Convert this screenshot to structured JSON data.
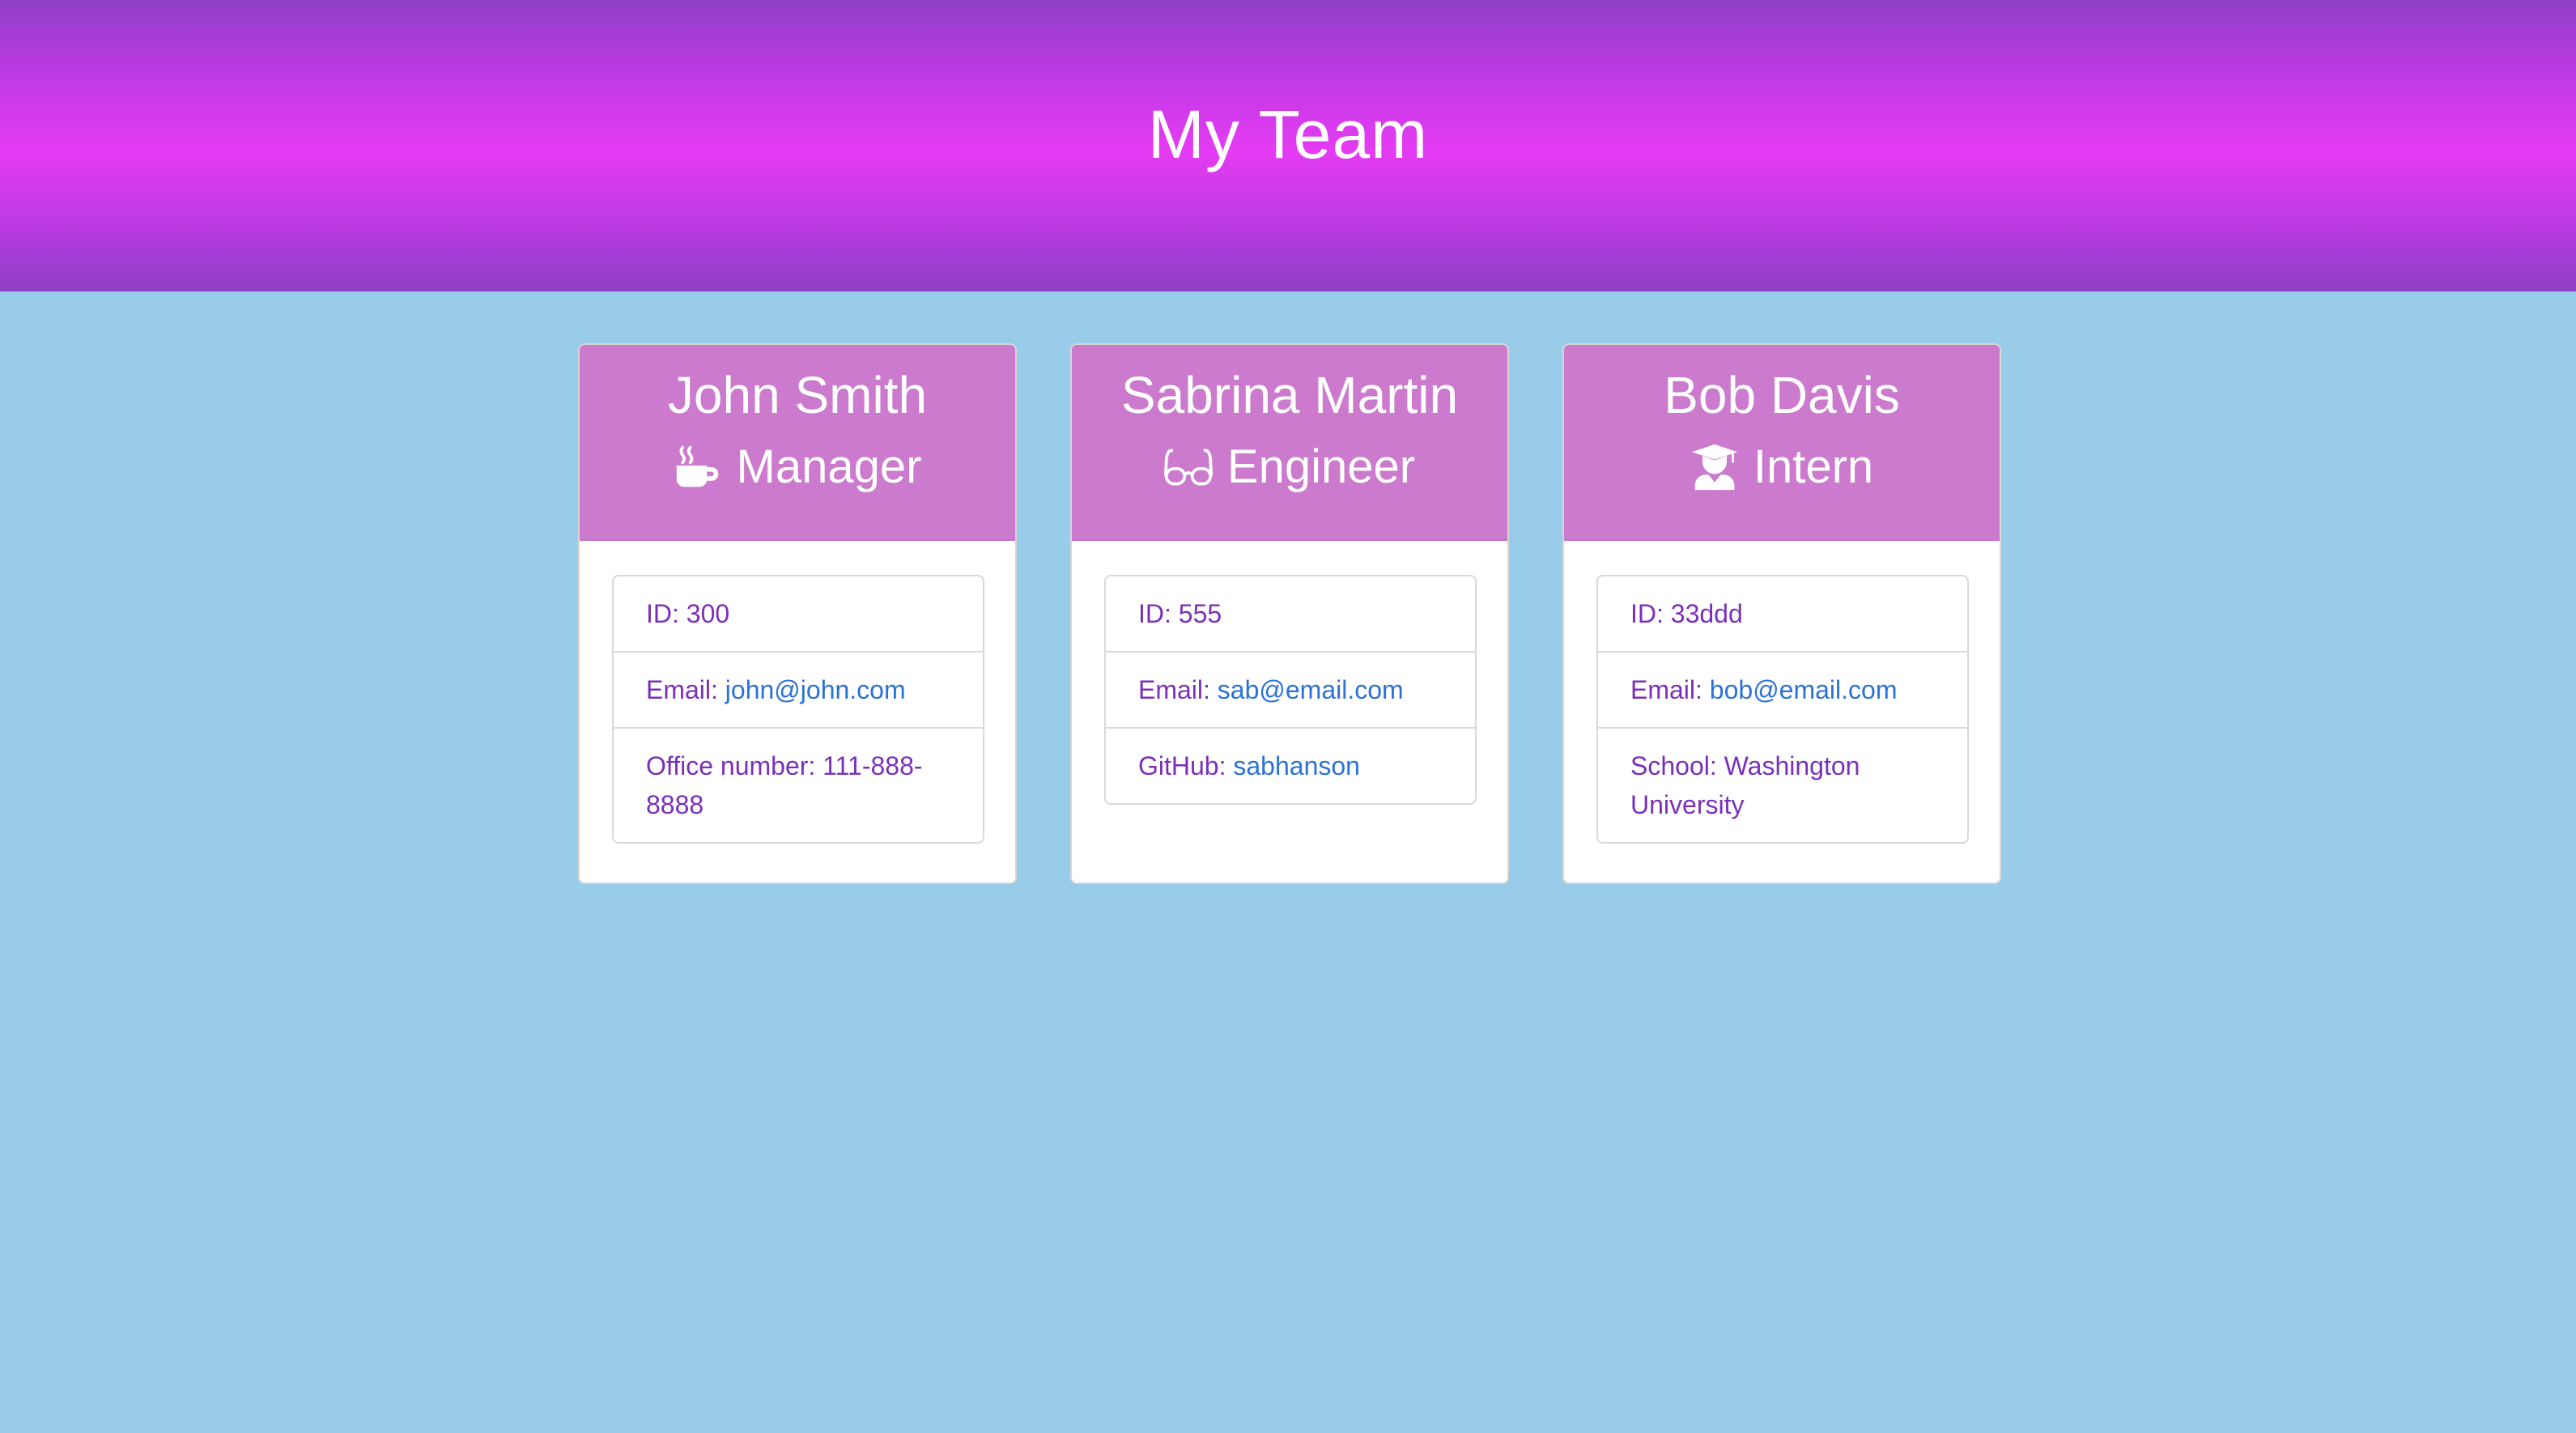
{
  "header": {
    "title": "My Team"
  },
  "employees": [
    {
      "name": "John Smith",
      "role": "Manager",
      "icon": "coffee-mug-icon",
      "id_label": "ID:",
      "id_value": "300",
      "email_label": "Email:",
      "email": "john@john.com",
      "extra_label": "Office number:",
      "extra_value": "111-888-8888"
    },
    {
      "name": "Sabrina Martin",
      "role": "Engineer",
      "icon": "glasses-icon",
      "id_label": "ID:",
      "id_value": "555",
      "email_label": "Email:",
      "email": "sab@email.com",
      "extra_label": "GitHub:",
      "extra_value": "sabhanson"
    },
    {
      "name": "Bob Davis",
      "role": "Intern",
      "icon": "graduate-icon",
      "id_label": "ID:",
      "id_value": "33ddd",
      "email_label": "Email:",
      "email": "bob@email.com",
      "extra_label": "School:",
      "extra_value": "Washington University"
    }
  ],
  "colors": {
    "header_gradient_mid": "#e53bf4",
    "header_gradient_edge": "#8e3fc6",
    "page_background": "#99cce8",
    "card_header": "#cb7ace",
    "text_purple": "#7b2fb9",
    "link_blue": "#2a72d8"
  }
}
